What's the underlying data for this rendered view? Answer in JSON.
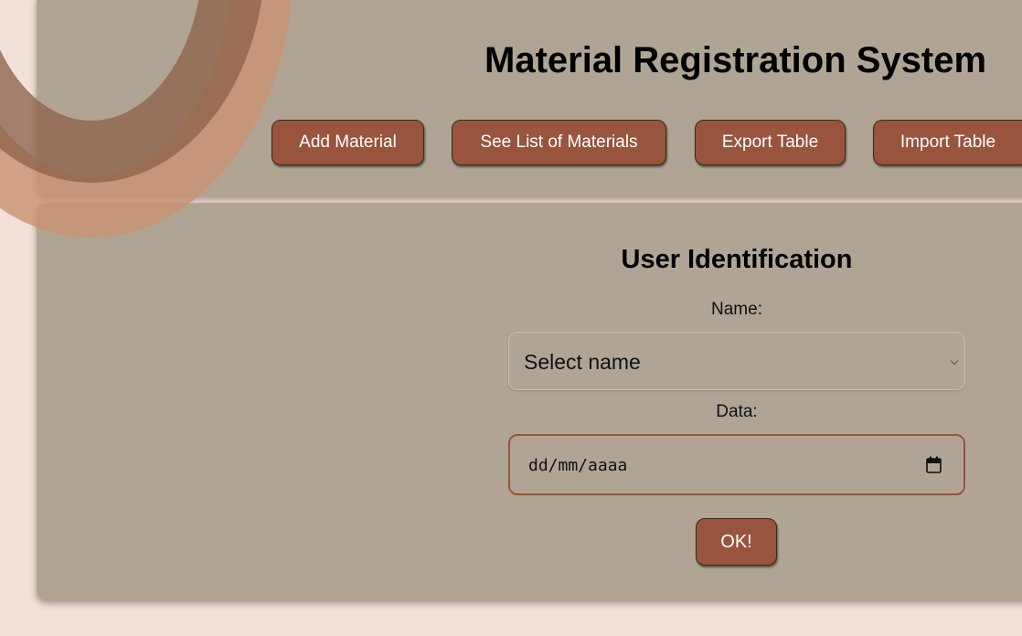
{
  "header": {
    "title": "Material Registration System",
    "nav": [
      {
        "label": "Add Material"
      },
      {
        "label": "See List of Materials"
      },
      {
        "label": "Export Table"
      },
      {
        "label": "Import Table"
      }
    ]
  },
  "form": {
    "title": "User Identification",
    "name_label": "Name:",
    "name_select_value": "Select name",
    "date_label": "Data:",
    "date_placeholder": "dd/mm/aaaa",
    "submit_label": "OK!"
  },
  "colors": {
    "background": "#f2e1d8",
    "panel": "#b0a594",
    "button": "#98543d",
    "arc_light": "#c99273",
    "arc_dark": "#8e634b"
  },
  "icons": {
    "select_arrow": "chevron-down-icon",
    "date_picker": "calendar-icon"
  }
}
